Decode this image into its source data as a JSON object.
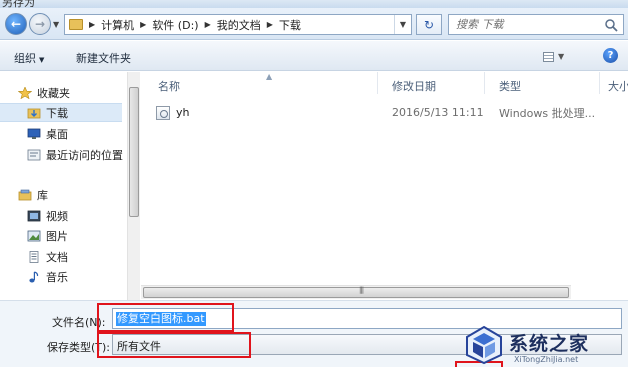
{
  "window": {
    "title": "另存为"
  },
  "addressbar": {
    "crumbs": [
      "计算机",
      "软件 (D:)",
      "我的文档",
      "下载"
    ]
  },
  "search": {
    "placeholder": "搜索 下载"
  },
  "toolbar": {
    "organize_label": "组织",
    "new_folder_label": "新建文件夹"
  },
  "navigation": {
    "favorites_label": "收藏夹",
    "favorites": [
      "下载",
      "桌面",
      "最近访问的位置"
    ],
    "library_label": "库",
    "libraries": [
      "视频",
      "图片",
      "文档",
      "音乐"
    ]
  },
  "file_list": {
    "columns": [
      "名称",
      "修改日期",
      "类型",
      "大小"
    ],
    "rows": [
      {
        "name": "yh",
        "date": "2016/5/13 11:11",
        "type": "Windows 批处理..."
      }
    ]
  },
  "form": {
    "filename_label": "文件名(N):",
    "filename_value": "修复空白图标.bat",
    "filetype_label": "保存类型(T):",
    "filetype_value": "所有文件"
  },
  "watermark": {
    "name": "系统之家",
    "url": "XiTongZhiJia.net"
  },
  "colors": {
    "highlight_box": "#e0141c",
    "selection": "#3399ff",
    "nav_selected": "#dceaf8"
  }
}
